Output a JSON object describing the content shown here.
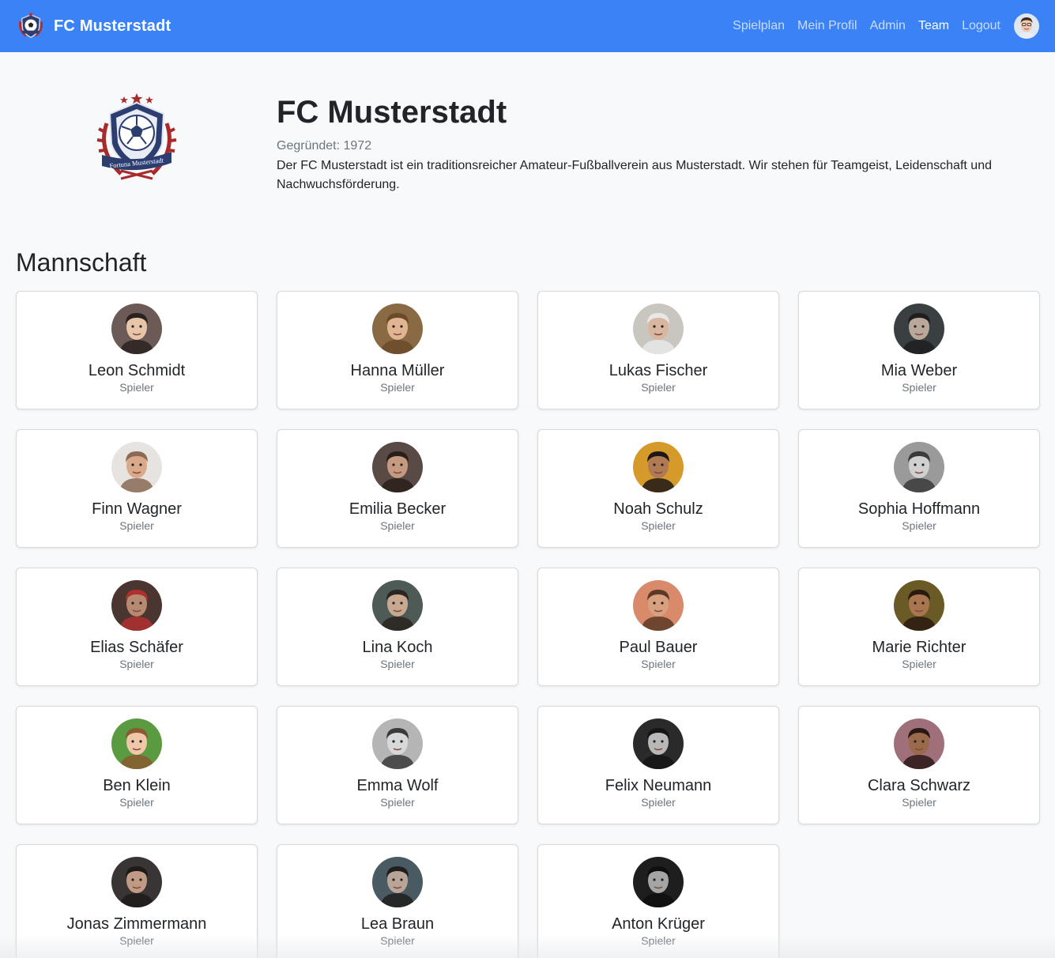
{
  "navbar": {
    "brand": "FC Musterstadt",
    "links": [
      {
        "label": "Spielplan",
        "active": false
      },
      {
        "label": "Mein Profil",
        "active": false
      },
      {
        "label": "Admin",
        "active": false
      },
      {
        "label": "Team",
        "active": true
      },
      {
        "label": "Logout",
        "active": false
      }
    ],
    "accent_color": "#3b82f6"
  },
  "club": {
    "name": "FC Musterstadt",
    "founded": "Gegründet: 1972",
    "description": "Der FC Musterstadt ist ein traditionsreicher Amateur-Fußballverein aus Musterstadt. Wir stehen für Teamgeist, Leidenschaft und Nachwuchsförderung.",
    "logo_text": "Fortuna Musterstadt"
  },
  "team": {
    "title": "Mannschaft",
    "players": [
      {
        "name": "Leon Schmidt",
        "role": "Spieler",
        "bg": "#6b5a55",
        "skin": "#e8c4a8",
        "hair": "#2a2220"
      },
      {
        "name": "Hanna Müller",
        "role": "Spieler",
        "bg": "#8a6a45",
        "skin": "#e2b592",
        "hair": "#6b4a2a"
      },
      {
        "name": "Lukas Fischer",
        "role": "Spieler",
        "bg": "#c9c6c0",
        "skin": "#d8b6a0",
        "hair": "#e8e8e8"
      },
      {
        "name": "Mia Weber",
        "role": "Spieler",
        "bg": "#3a3f42",
        "skin": "#b9a89a",
        "hair": "#1e1e1e"
      },
      {
        "name": "Finn Wagner",
        "role": "Spieler",
        "bg": "#e6e3e0",
        "skin": "#d9a98a",
        "hair": "#8a6a55"
      },
      {
        "name": "Emilia Becker",
        "role": "Spieler",
        "bg": "#5a4a45",
        "skin": "#c59a80",
        "hair": "#2a1e1a"
      },
      {
        "name": "Noah Schulz",
        "role": "Spieler",
        "bg": "#d69a2a",
        "skin": "#b07a55",
        "hair": "#1e1815"
      },
      {
        "name": "Sophia Hoffmann",
        "role": "Spieler",
        "bg": "#9a9a9a",
        "skin": "#d0d0d0",
        "hair": "#3a3a3a"
      },
      {
        "name": "Elias Schäfer",
        "role": "Spieler",
        "bg": "#4a3530",
        "skin": "#b58a70",
        "hair": "#b03030"
      },
      {
        "name": "Lina Koch",
        "role": "Spieler",
        "bg": "#4e5a55",
        "skin": "#c8a890",
        "hair": "#2a2520"
      },
      {
        "name": "Paul Bauer",
        "role": "Spieler",
        "bg": "#d98a6a",
        "skin": "#d9a080",
        "hair": "#5a3a25"
      },
      {
        "name": "Marie Richter",
        "role": "Spieler",
        "bg": "#6a5a25",
        "skin": "#a8754f",
        "hair": "#2a1a10"
      },
      {
        "name": "Ben Klein",
        "role": "Spieler",
        "bg": "#5a9a40",
        "skin": "#f0c8a8",
        "hair": "#8a5a30"
      },
      {
        "name": "Emma Wolf",
        "role": "Spieler",
        "bg": "#b5b5b5",
        "skin": "#d8d8d8",
        "hair": "#3a3a3a"
      },
      {
        "name": "Felix Neumann",
        "role": "Spieler",
        "bg": "#2a2a2a",
        "skin": "#b8b8b8",
        "hair": "#151515"
      },
      {
        "name": "Clara Schwarz",
        "role": "Spieler",
        "bg": "#a0707a",
        "skin": "#9a6a4a",
        "hair": "#2a1815"
      },
      {
        "name": "Jonas Zimmermann",
        "role": "Spieler",
        "bg": "#3a3535",
        "skin": "#c09a85",
        "hair": "#1e1a1a"
      },
      {
        "name": "Lea Braun",
        "role": "Spieler",
        "bg": "#4a5a62",
        "skin": "#b8a598",
        "hair": "#1e1e1e"
      },
      {
        "name": "Anton Krüger",
        "role": "Spieler",
        "bg": "#1e1e1e",
        "skin": "#a5a5a5",
        "hair": "#0f0f0f"
      }
    ]
  }
}
